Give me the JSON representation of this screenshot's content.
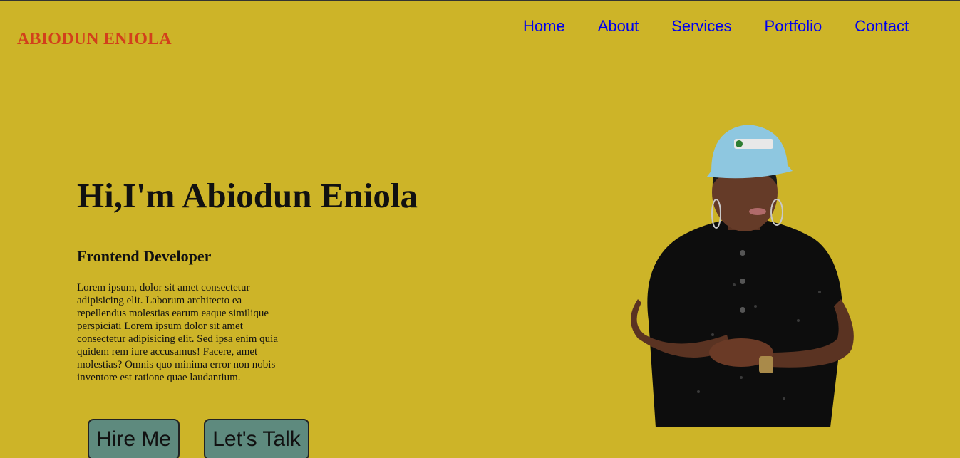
{
  "brand": {
    "name": "ABIODUN ENIOLA"
  },
  "nav": {
    "items": [
      {
        "label": "Home"
      },
      {
        "label": "About"
      },
      {
        "label": "Services"
      },
      {
        "label": "Portfolio"
      },
      {
        "label": "Contact"
      }
    ]
  },
  "hero": {
    "title": "Hi,I'm Abiodun Eniola",
    "role": "Frontend Developer",
    "description": "Lorem ipsum, dolor sit amet consectetur adipisicing elit. Laborum architecto ea repellendus molestias earum eaque similique perspiciati Lorem ipsum dolor sit amet consectetur adipisicing elit. Sed ipsa enim quia quidem rem iure accusamus! Facere, amet molestias? Omnis quo minima error non nobis inventore est ratione quae laudantium.",
    "buttons": {
      "hire": "Hire Me",
      "talk": "Let's Talk"
    }
  },
  "colors": {
    "background": "#cdb428",
    "brand": "#d2401b",
    "nav_link": "#0000ee",
    "button": "#5e8a7e"
  }
}
